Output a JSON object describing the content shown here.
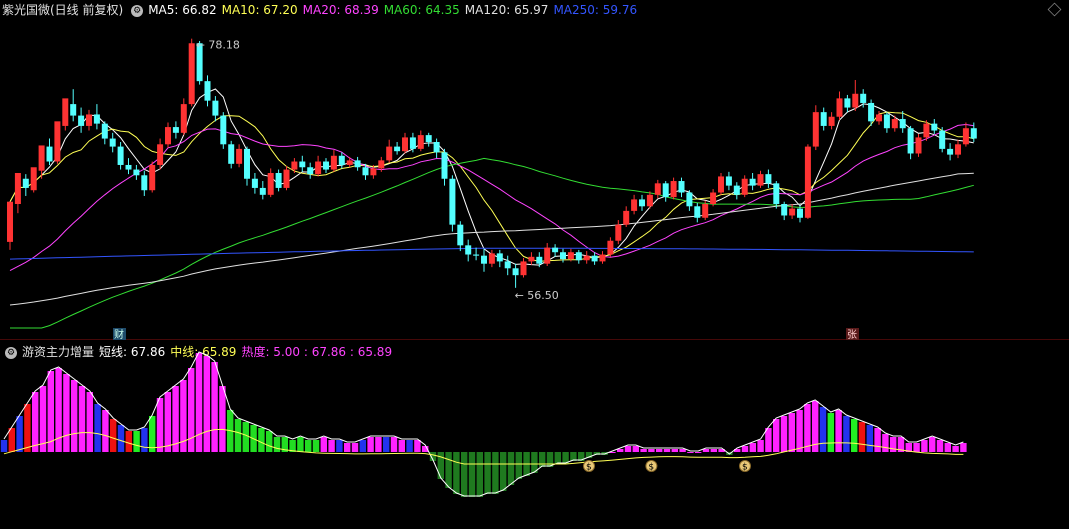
{
  "header": {
    "stock_label": "紫光国微(日线 前复权)",
    "ma": [
      {
        "label": "MA5: 66.82",
        "color": "#ffffff"
      },
      {
        "label": "MA10: 67.20",
        "color": "#ffff55"
      },
      {
        "label": "MA20: 68.39",
        "color": "#ff44ff"
      },
      {
        "label": "MA60: 64.35",
        "color": "#33dd33"
      },
      {
        "label": "MA120: 65.97",
        "color": "#e0e0e0"
      },
      {
        "label": "MA250: 59.76",
        "color": "#3355ff"
      }
    ]
  },
  "annotations": {
    "high": "78.18",
    "low": "56.50",
    "marker_cai": "财",
    "marker_zhang": "张"
  },
  "indicator_header": {
    "name": "游资主力增量",
    "short_label": "短线: 67.86",
    "mid_label": "中线: 65.89",
    "heat_label": "热度: 5.00 : 67.86 : 65.89",
    "colors": {
      "short": "#ffffff",
      "mid": "#ffff55",
      "heat": "#ff44ff"
    }
  },
  "chart_data": [
    {
      "type": "candlestick",
      "title": "紫光国微(日线 前复权)",
      "ylim": [
        53,
        80
      ],
      "candles": [
        [
          60.5,
          64.0,
          59.8,
          63.8
        ],
        [
          63.8,
          66.5,
          63.0,
          66.2
        ],
        [
          66.0,
          65.2,
          64.5,
          66.4
        ],
        [
          65.0,
          67.0,
          64.8,
          66.7
        ],
        [
          66.7,
          68.9,
          66.0,
          68.8
        ],
        [
          68.8,
          67.5,
          67.2,
          69.5
        ],
        [
          67.5,
          71.0,
          67.3,
          70.6
        ],
        [
          70.6,
          73.0,
          70.2,
          72.5
        ],
        [
          72.5,
          71.5,
          71.0,
          73.8
        ],
        [
          71.5,
          70.6,
          70.0,
          72.2
        ],
        [
          70.6,
          71.6,
          70.2,
          72.0
        ],
        [
          71.6,
          70.8,
          70.3,
          72.5
        ],
        [
          70.8,
          69.5,
          69.0,
          71.0
        ],
        [
          69.5,
          68.8,
          68.3,
          70.0
        ],
        [
          68.8,
          67.2,
          66.8,
          69.2
        ],
        [
          67.2,
          66.8,
          66.4,
          67.8
        ],
        [
          66.8,
          66.3,
          65.9,
          67.2
        ],
        [
          66.3,
          65.0,
          64.5,
          66.7
        ],
        [
          65.0,
          67.2,
          64.8,
          67.5
        ],
        [
          67.2,
          69.0,
          66.8,
          69.5
        ],
        [
          69.0,
          70.5,
          68.7,
          70.9
        ],
        [
          70.5,
          70.0,
          69.5,
          71.0
        ],
        [
          70.0,
          72.5,
          69.8,
          73.0
        ],
        [
          72.5,
          77.8,
          72.3,
          78.2
        ],
        [
          77.8,
          74.5,
          74.2,
          78.0
        ],
        [
          74.5,
          72.8,
          72.3,
          75.0
        ],
        [
          72.8,
          71.5,
          71.0,
          73.2
        ],
        [
          71.5,
          69.0,
          68.6,
          71.8
        ],
        [
          69.0,
          67.3,
          66.9,
          69.3
        ],
        [
          67.3,
          68.6,
          67.0,
          69.0
        ],
        [
          68.6,
          66.0,
          65.4,
          68.8
        ],
        [
          66.0,
          65.2,
          64.7,
          66.5
        ],
        [
          65.2,
          64.6,
          64.2,
          65.8
        ],
        [
          64.6,
          66.5,
          64.4,
          66.9
        ],
        [
          66.5,
          65.2,
          64.9,
          66.8
        ],
        [
          65.2,
          66.8,
          65.0,
          67.1
        ],
        [
          66.8,
          67.5,
          66.5,
          67.8
        ],
        [
          67.5,
          67.0,
          66.6,
          68.0
        ],
        [
          67.0,
          66.4,
          66.0,
          67.4
        ],
        [
          66.4,
          67.5,
          66.2,
          68.0
        ],
        [
          67.5,
          66.8,
          66.5,
          67.8
        ],
        [
          66.8,
          68.0,
          66.6,
          68.5
        ],
        [
          68.0,
          67.2,
          66.9,
          68.3
        ],
        [
          67.2,
          67.6,
          67.0,
          67.9
        ],
        [
          67.6,
          67.0,
          66.7,
          67.9
        ],
        [
          67.0,
          66.3,
          65.9,
          67.3
        ],
        [
          66.3,
          66.9,
          66.0,
          67.2
        ],
        [
          66.9,
          67.6,
          66.6,
          67.9
        ],
        [
          67.6,
          68.8,
          67.4,
          69.4
        ],
        [
          68.8,
          68.4,
          68.1,
          69.2
        ],
        [
          68.4,
          69.6,
          68.2,
          70.0
        ],
        [
          69.6,
          68.6,
          68.3,
          70.0
        ],
        [
          68.6,
          69.8,
          68.4,
          70.2
        ],
        [
          69.8,
          69.2,
          68.8,
          70.0
        ],
        [
          69.2,
          68.3,
          67.8,
          69.5
        ],
        [
          68.3,
          66.0,
          65.4,
          68.6
        ],
        [
          66.0,
          62.0,
          61.4,
          66.3
        ],
        [
          62.0,
          60.2,
          59.7,
          62.3
        ],
        [
          60.2,
          59.4,
          58.8,
          60.7
        ],
        [
          59.4,
          59.3,
          58.9,
          60.0
        ],
        [
          59.3,
          58.6,
          57.9,
          59.9
        ],
        [
          58.6,
          59.5,
          58.3,
          59.8
        ],
        [
          59.5,
          58.8,
          58.3,
          59.8
        ],
        [
          58.8,
          58.2,
          57.6,
          59.3
        ],
        [
          58.2,
          57.6,
          56.5,
          58.6
        ],
        [
          57.6,
          58.8,
          57.4,
          59.1
        ],
        [
          58.8,
          59.2,
          58.5,
          59.6
        ],
        [
          59.2,
          58.6,
          58.3,
          59.6
        ],
        [
          58.6,
          60.0,
          58.4,
          60.4
        ],
        [
          60.0,
          59.6,
          59.2,
          60.3
        ],
        [
          59.6,
          59.0,
          58.7,
          59.9
        ],
        [
          59.0,
          59.6,
          58.8,
          59.9
        ],
        [
          59.6,
          58.9,
          58.6,
          59.8
        ],
        [
          58.9,
          59.3,
          58.6,
          59.7
        ],
        [
          59.3,
          58.8,
          58.5,
          59.6
        ],
        [
          58.8,
          59.4,
          58.6,
          59.7
        ],
        [
          59.4,
          60.6,
          59.2,
          60.9
        ],
        [
          60.6,
          62.0,
          60.3,
          62.4
        ],
        [
          62.0,
          63.2,
          61.8,
          63.6
        ],
        [
          63.2,
          64.2,
          62.9,
          64.6
        ],
        [
          64.2,
          63.6,
          63.2,
          64.6
        ],
        [
          63.6,
          64.6,
          63.4,
          64.9
        ],
        [
          64.6,
          65.6,
          64.3,
          65.9
        ],
        [
          65.6,
          64.4,
          64.0,
          65.8
        ],
        [
          64.4,
          65.8,
          64.2,
          66.1
        ],
        [
          65.8,
          64.8,
          64.4,
          66.1
        ],
        [
          64.8,
          63.6,
          63.2,
          65.0
        ],
        [
          63.6,
          62.6,
          62.2,
          63.9
        ],
        [
          62.6,
          63.8,
          62.4,
          64.1
        ],
        [
          63.8,
          64.8,
          63.6,
          65.1
        ],
        [
          64.8,
          66.2,
          64.6,
          66.5
        ],
        [
          66.2,
          65.4,
          65.0,
          66.6
        ],
        [
          65.4,
          64.6,
          64.2,
          65.7
        ],
        [
          64.6,
          66.0,
          64.4,
          66.3
        ],
        [
          66.0,
          65.4,
          65.0,
          66.5
        ],
        [
          65.4,
          66.4,
          65.2,
          66.7
        ],
        [
          66.4,
          65.6,
          65.2,
          66.8
        ],
        [
          65.6,
          63.8,
          63.4,
          65.8
        ],
        [
          63.8,
          62.8,
          62.4,
          64.0
        ],
        [
          62.8,
          63.4,
          62.5,
          63.8
        ],
        [
          63.4,
          62.6,
          62.2,
          63.7
        ],
        [
          62.6,
          68.8,
          62.5,
          69.0
        ],
        [
          68.8,
          71.8,
          68.5,
          72.4
        ],
        [
          71.8,
          70.6,
          70.2,
          72.2
        ],
        [
          70.6,
          71.4,
          70.3,
          71.8
        ],
        [
          71.4,
          73.0,
          71.1,
          73.6
        ],
        [
          73.0,
          72.2,
          71.8,
          73.3
        ],
        [
          72.2,
          73.4,
          71.9,
          74.6
        ],
        [
          73.4,
          72.6,
          72.2,
          73.8
        ],
        [
          72.6,
          71.0,
          70.6,
          72.9
        ],
        [
          71.0,
          71.6,
          70.7,
          71.9
        ],
        [
          71.6,
          70.4,
          70.0,
          71.8
        ],
        [
          70.4,
          71.2,
          70.1,
          71.5
        ],
        [
          71.2,
          70.4,
          70.0,
          71.9
        ],
        [
          70.4,
          68.2,
          67.7,
          70.6
        ],
        [
          68.2,
          69.6,
          67.9,
          69.9
        ],
        [
          69.6,
          70.8,
          69.3,
          71.1
        ],
        [
          70.8,
          70.2,
          69.9,
          71.2
        ],
        [
          70.2,
          68.6,
          68.3,
          70.5
        ],
        [
          68.6,
          68.1,
          67.6,
          69.1
        ],
        [
          68.1,
          69.0,
          67.8,
          69.4
        ],
        [
          69.0,
          70.4,
          68.8,
          70.9
        ],
        [
          70.4,
          69.5,
          69.2,
          70.9
        ]
      ],
      "ma_lines": [
        {
          "name": "MA5",
          "color": "#ffffff",
          "values": []
        },
        {
          "name": "MA10",
          "color": "#ffff55",
          "values": []
        },
        {
          "name": "MA20",
          "color": "#ff44ff",
          "values": []
        },
        {
          "name": "MA60",
          "color": "#33dd33",
          "values": []
        },
        {
          "name": "MA120",
          "color": "#e0e0e0",
          "values": []
        },
        {
          "name": "MA250",
          "color": "#3355ff",
          "values": []
        }
      ]
    },
    {
      "type": "bar",
      "title": "游资主力增量",
      "ylim": [
        -25,
        40
      ],
      "values": [
        4,
        8,
        12,
        16,
        20,
        22,
        27,
        28,
        26,
        24,
        22,
        20,
        16,
        14,
        11,
        9,
        7,
        7,
        8,
        12,
        18,
        20,
        22,
        24,
        28,
        33,
        32,
        30,
        22,
        14,
        11,
        10,
        9,
        8,
        7,
        5,
        5,
        4,
        5,
        4,
        4,
        5,
        4,
        4,
        3,
        3,
        4,
        5,
        5,
        5,
        5,
        4,
        4,
        4,
        2,
        -3,
        -9,
        -12,
        -14,
        -15,
        -15,
        -15,
        -14,
        -14,
        -13,
        -11,
        -9,
        -8,
        -7,
        -5,
        -5,
        -4,
        -4,
        -3,
        -3,
        -2,
        -1,
        -1,
        0,
        1,
        2,
        2,
        1,
        1,
        1,
        1,
        1,
        1,
        0,
        0,
        1,
        1,
        1,
        -1,
        1,
        2,
        3,
        4,
        8,
        11,
        12,
        13,
        14,
        16,
        17,
        15,
        13,
        14,
        12,
        11,
        10,
        9,
        8,
        6,
        5,
        5,
        3,
        3,
        4,
        5,
        4,
        3,
        2,
        3
      ],
      "markers": [
        75,
        83,
        95
      ]
    }
  ]
}
